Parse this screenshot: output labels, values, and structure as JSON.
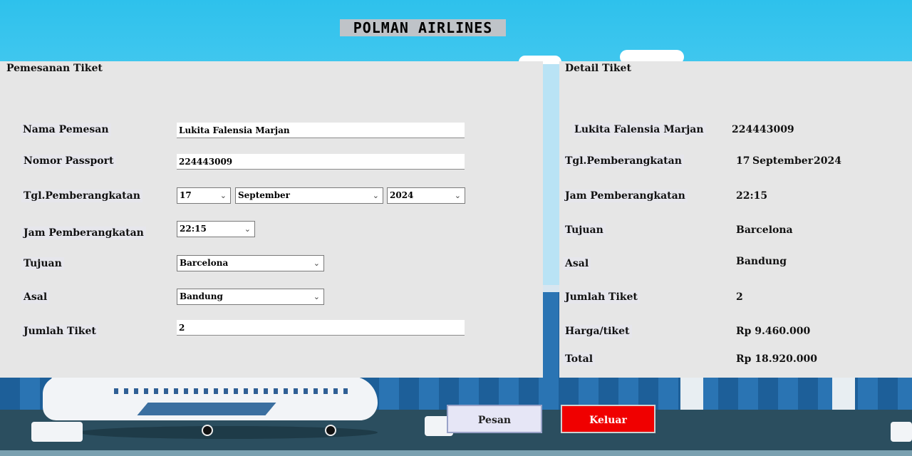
{
  "app": {
    "title": "POLMAN AIRLINES"
  },
  "booking": {
    "title": "Pemesanan Tiket",
    "labels": {
      "name": "Nama Pemesan",
      "passport": "Nomor Passport",
      "date": "Tgl.Pemberangkatan",
      "time": "Jam Pemberangkatan",
      "destination": "Tujuan",
      "origin": "Asal",
      "quantity": "Jumlah Tiket"
    },
    "values": {
      "name": "Lukita Falensia Marjan",
      "passport": "224443009",
      "day": "17",
      "month": "September",
      "year": "2024",
      "time": "22:15",
      "destination": "Barcelona",
      "origin": "Bandung",
      "quantity": "2"
    }
  },
  "detail": {
    "title": "Detail Tiket",
    "name": "Lukita Falensia Marjan",
    "passport": "224443009",
    "labels": {
      "date": "Tgl.Pemberangkatan",
      "time": "Jam Pemberangkatan",
      "destination": "Tujuan",
      "origin": "Asal",
      "quantity": "Jumlah Tiket",
      "price": "Harga/tiket",
      "total": "Total"
    },
    "values": {
      "day": "17",
      "month": "September",
      "year": "2024",
      "time": "22:15",
      "destination": "Barcelona",
      "origin": "Bandung",
      "quantity": "2",
      "price": "Rp 9.460.000",
      "total": "Rp 18.920.000"
    }
  },
  "buttons": {
    "order": "Pesan",
    "exit": "Keluar"
  },
  "colors": {
    "exit_button": "#f00000",
    "panel": "#e6e6e6",
    "sky": "#2ec1ec"
  },
  "icons": {
    "dropdown": "chevron-down-icon"
  }
}
